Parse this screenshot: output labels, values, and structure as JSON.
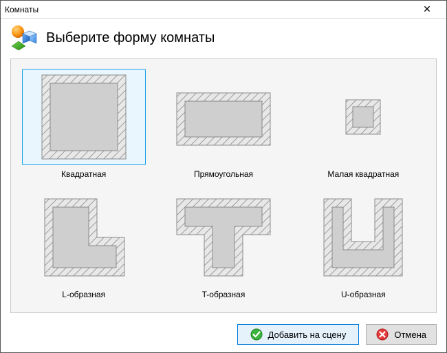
{
  "window": {
    "title": "Комнаты",
    "close_label": "✕"
  },
  "header": {
    "heading": "Выберите форму комнаты"
  },
  "shapes": [
    {
      "label": "Квадратная",
      "selected": true
    },
    {
      "label": "Прямоугольная",
      "selected": false
    },
    {
      "label": "Малая квадратная",
      "selected": false
    },
    {
      "label": "L-образная",
      "selected": false
    },
    {
      "label": "T-образная",
      "selected": false
    },
    {
      "label": "U-образная",
      "selected": false
    }
  ],
  "footer": {
    "ok_label": "Добавить на сцену",
    "cancel_label": "Отмена"
  }
}
